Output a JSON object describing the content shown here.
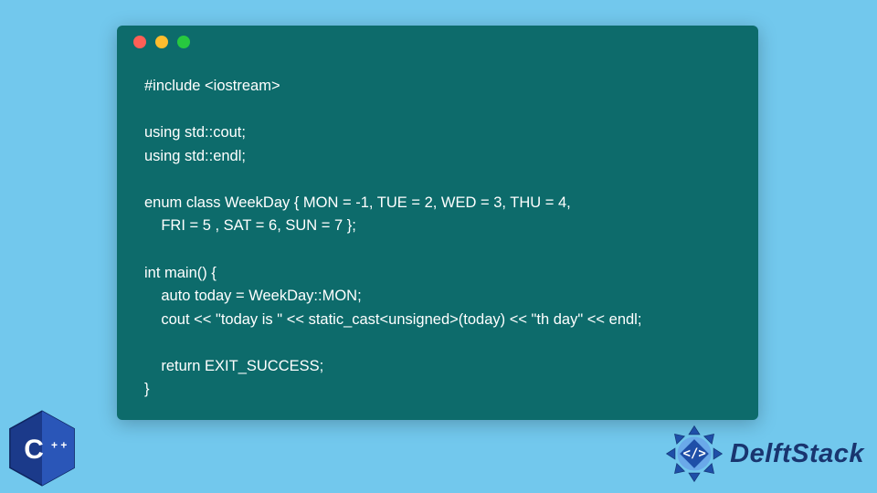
{
  "window": {
    "traffic_lights": {
      "red": "#ff5f56",
      "yellow": "#ffbd2e",
      "green": "#27c93f"
    },
    "background": "#0d6b6b"
  },
  "code": {
    "lines": [
      "#include <iostream>",
      "",
      "using std::cout;",
      "using std::endl;",
      "",
      "enum class WeekDay { MON = -1, TUE = 2, WED = 3, THU = 4,",
      "    FRI = 5 , SAT = 6, SUN = 7 };",
      "",
      "int main() {",
      "    auto today = WeekDay::MON;",
      "    cout << \"today is \" << static_cast<unsigned>(today) << \"th day\" << endl;",
      "",
      "    return EXIT_SUCCESS;",
      "}"
    ]
  },
  "logos": {
    "cpp_label": "C++",
    "delftstack_label": "DelftStack",
    "delftstack_badge_text": "</>"
  },
  "colors": {
    "page_bg": "#72c8ed",
    "brand_text": "#19356f",
    "cpp_blue": "#1b3a8a",
    "ds_badge": "#1f4fa8"
  }
}
